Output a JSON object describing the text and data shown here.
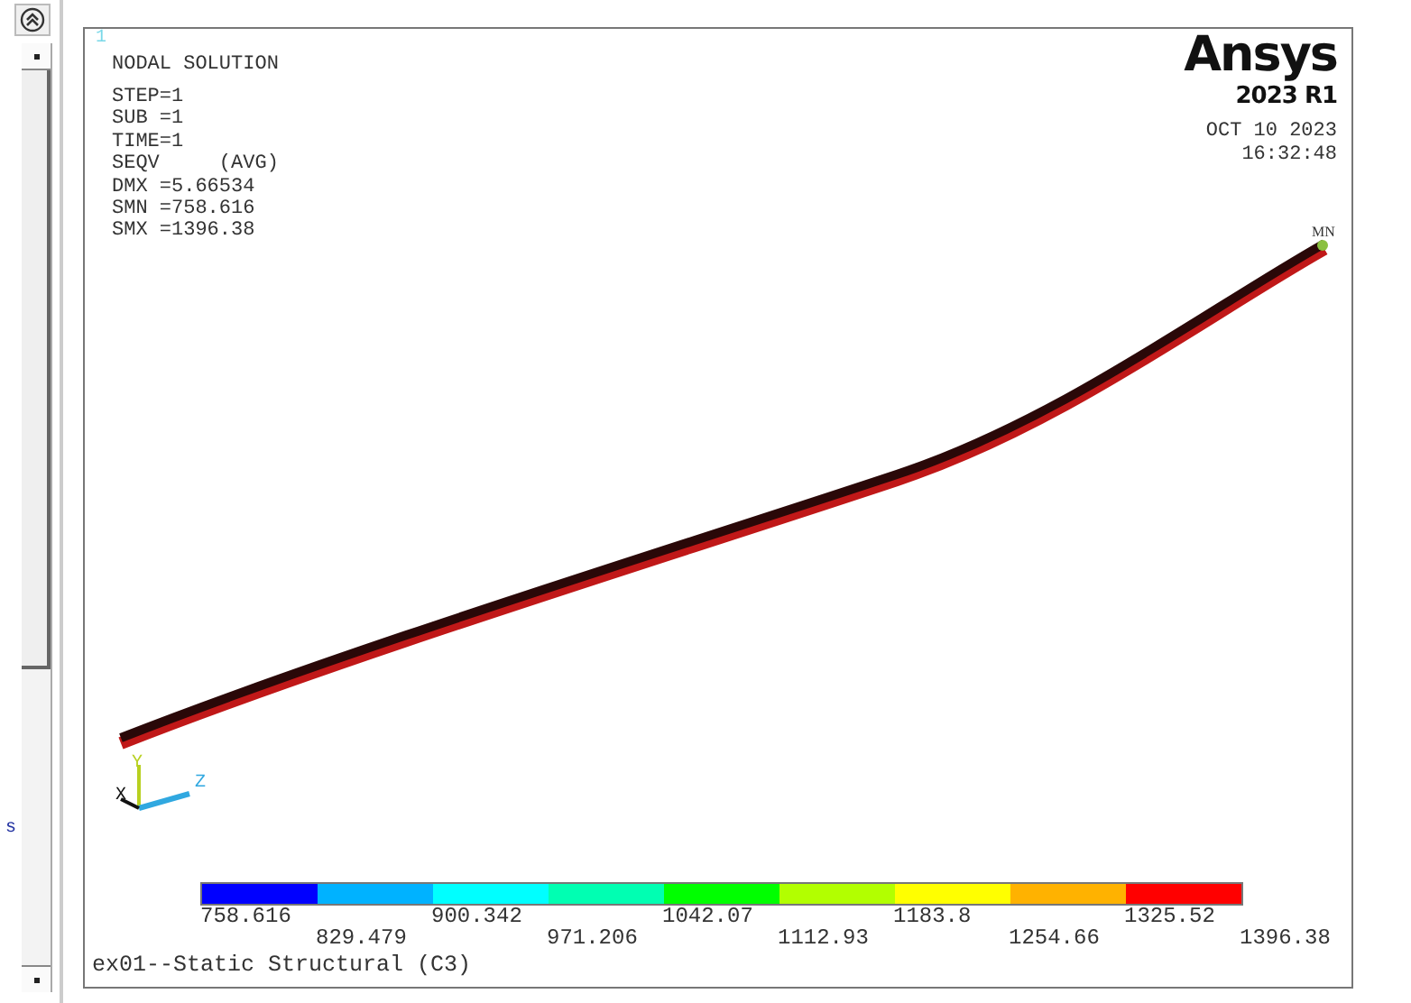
{
  "window_number": "1",
  "title": "NODAL SOLUTION",
  "info_lines": [
    "STEP=1",
    "SUB =1",
    "TIME=1",
    "SEQV     (AVG)",
    "DMX =5.66534",
    "SMN =758.616",
    "SMX =1396.38"
  ],
  "logo": {
    "brand": "Ansys",
    "release": "2023 R1"
  },
  "date": "OCT 10 2023",
  "time": "16:32:48",
  "node_label": "MN",
  "triad": {
    "x": "X",
    "y": "Y",
    "z": "Z"
  },
  "legend": {
    "bands": [
      {
        "color": "#0000ff"
      },
      {
        "color": "#00b2ff"
      },
      {
        "color": "#00ffff"
      },
      {
        "color": "#00ffb2"
      },
      {
        "color": "#00ff00"
      },
      {
        "color": "#b2ff00"
      },
      {
        "color": "#ffff00"
      },
      {
        "color": "#ffb200"
      },
      {
        "color": "#ff0000"
      }
    ],
    "labels": [
      "758.616",
      "829.479",
      "900.342",
      "971.206",
      "1042.07",
      "1112.93",
      "1183.8",
      "1254.66",
      "1325.52",
      "1396.38"
    ]
  },
  "footer": "ex01--Static Structural (C3)",
  "side_text": "s"
}
